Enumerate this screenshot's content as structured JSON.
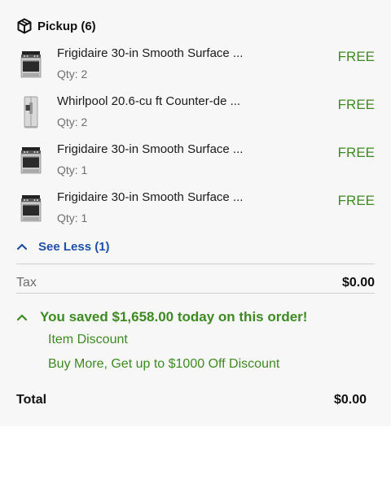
{
  "pickup": {
    "icon": "box-icon",
    "title": "Pickup (6)"
  },
  "items": [
    {
      "name": "Frigidaire 30-in Smooth Surface ...",
      "qty": "Qty: 2",
      "price": "FREE",
      "thumb_icon": "range-icon"
    },
    {
      "name": "Whirlpool 20.6-cu ft Counter-de ...",
      "qty": "Qty: 2",
      "price": "FREE",
      "thumb_icon": "refrigerator-icon"
    },
    {
      "name": "Frigidaire 30-in Smooth Surface ...",
      "qty": "Qty: 1",
      "price": "FREE",
      "thumb_icon": "range-icon"
    },
    {
      "name": "Frigidaire 30-in Smooth Surface ...",
      "qty": "Qty: 1",
      "price": "FREE",
      "thumb_icon": "range-icon"
    }
  ],
  "see_less": {
    "icon": "chevron-up-icon",
    "label": "See Less (1)"
  },
  "tax": {
    "label": "Tax",
    "value": "$0.00"
  },
  "savings": {
    "icon": "chevron-up-icon",
    "label": "You saved $1,658.00 today on this order!",
    "discounts": [
      "Item Discount",
      "Buy More, Get up to $1000 Off Discount"
    ]
  },
  "total": {
    "label": "Total",
    "value": "$0.00"
  },
  "colors": {
    "green": "#3e8a22",
    "link_blue": "#1f4fa8",
    "muted_gray": "#6f6f6f",
    "panel_bg": "#f7f7f7"
  }
}
